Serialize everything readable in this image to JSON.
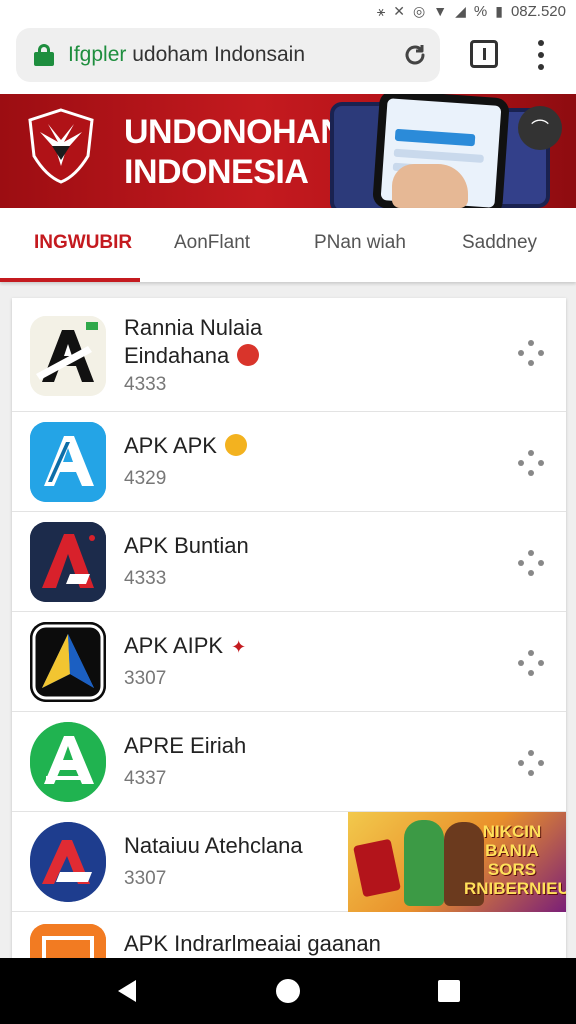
{
  "status_bar": {
    "time": "08Z.520",
    "battery_percent": "%"
  },
  "browser": {
    "url_host": "Ifgpler",
    "url_path": "udoham Indonsain"
  },
  "banner": {
    "title_line1": "UNDONOHAN",
    "title_line2": "INDONESIA"
  },
  "category_tabs": [
    {
      "label": "INGWUBIR",
      "active": true
    },
    {
      "label": "AonFlant",
      "active": false
    },
    {
      "label": "PNan wiah",
      "active": false
    },
    {
      "label": "Saddney",
      "active": false
    }
  ],
  "apps": [
    {
      "name_line1": "Rannia Nulaia",
      "name_line2": "Eindahana",
      "sub": "4333",
      "icon": "black-white-a-icon",
      "badge": "red-emoji"
    },
    {
      "name_line1": "APK APK",
      "sub": "4329",
      "icon": "blue-a-icon",
      "badge": "yellow-emoji"
    },
    {
      "name_line1": "APK Buntian",
      "sub": "4333",
      "icon": "red-navy-a-icon"
    },
    {
      "name_line1": "APK AIPK",
      "sub": "3307",
      "icon": "black-blue-arrow-icon",
      "badge": "red-star"
    },
    {
      "name_line1": "APRE Eiriah",
      "sub": "4337",
      "icon": "green-a-icon"
    },
    {
      "name_line1": "Nataiuu Atehclana",
      "sub": "3307",
      "icon": "navy-red-a-icon"
    },
    {
      "name_line1": "APK Indrarlmeaiai gaanan",
      "sub": "",
      "icon": "orange-icon"
    }
  ],
  "ad": {
    "text": "NIKCIN BANIA SORS RNIBERNIEU"
  },
  "colors": {
    "brand_red": "#c41a1f",
    "secure_green": "#1e8e3e"
  }
}
